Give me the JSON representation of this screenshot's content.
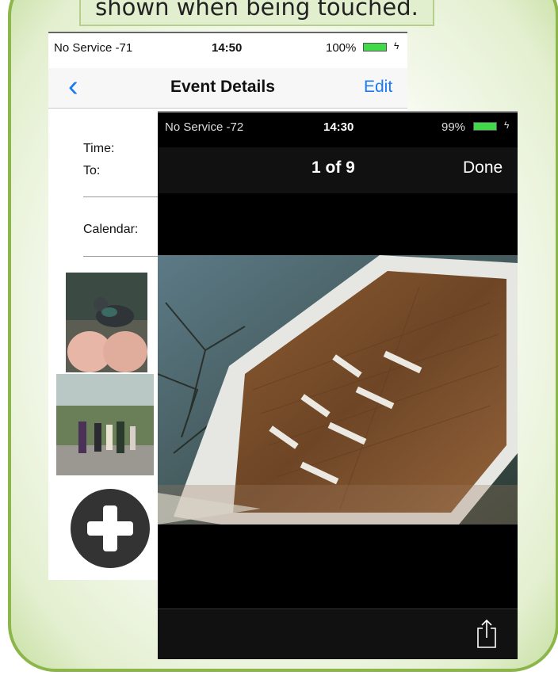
{
  "caption": "shown when being touched.",
  "event_screen": {
    "status": {
      "carrier": "No Service -71",
      "time": "14:50",
      "battery": "100%"
    },
    "nav": {
      "back_icon": "chevron-left-icon",
      "title": "Event Details",
      "edit_label": "Edit"
    },
    "fields": {
      "time_label": "Time:",
      "to_label": "To:",
      "calendar_label": "Calendar:"
    },
    "add_photo_icon": "plus-circle-icon"
  },
  "viewer_screen": {
    "status": {
      "carrier": "No Service -72",
      "time": "14:30",
      "battery": "99%"
    },
    "nav": {
      "counter": "1 of 9",
      "done_label": "Done"
    },
    "share_icon": "share-icon"
  },
  "colors": {
    "accent": "#1a7af3",
    "frame": "#8cb64a",
    "battery": "#41d84a"
  }
}
